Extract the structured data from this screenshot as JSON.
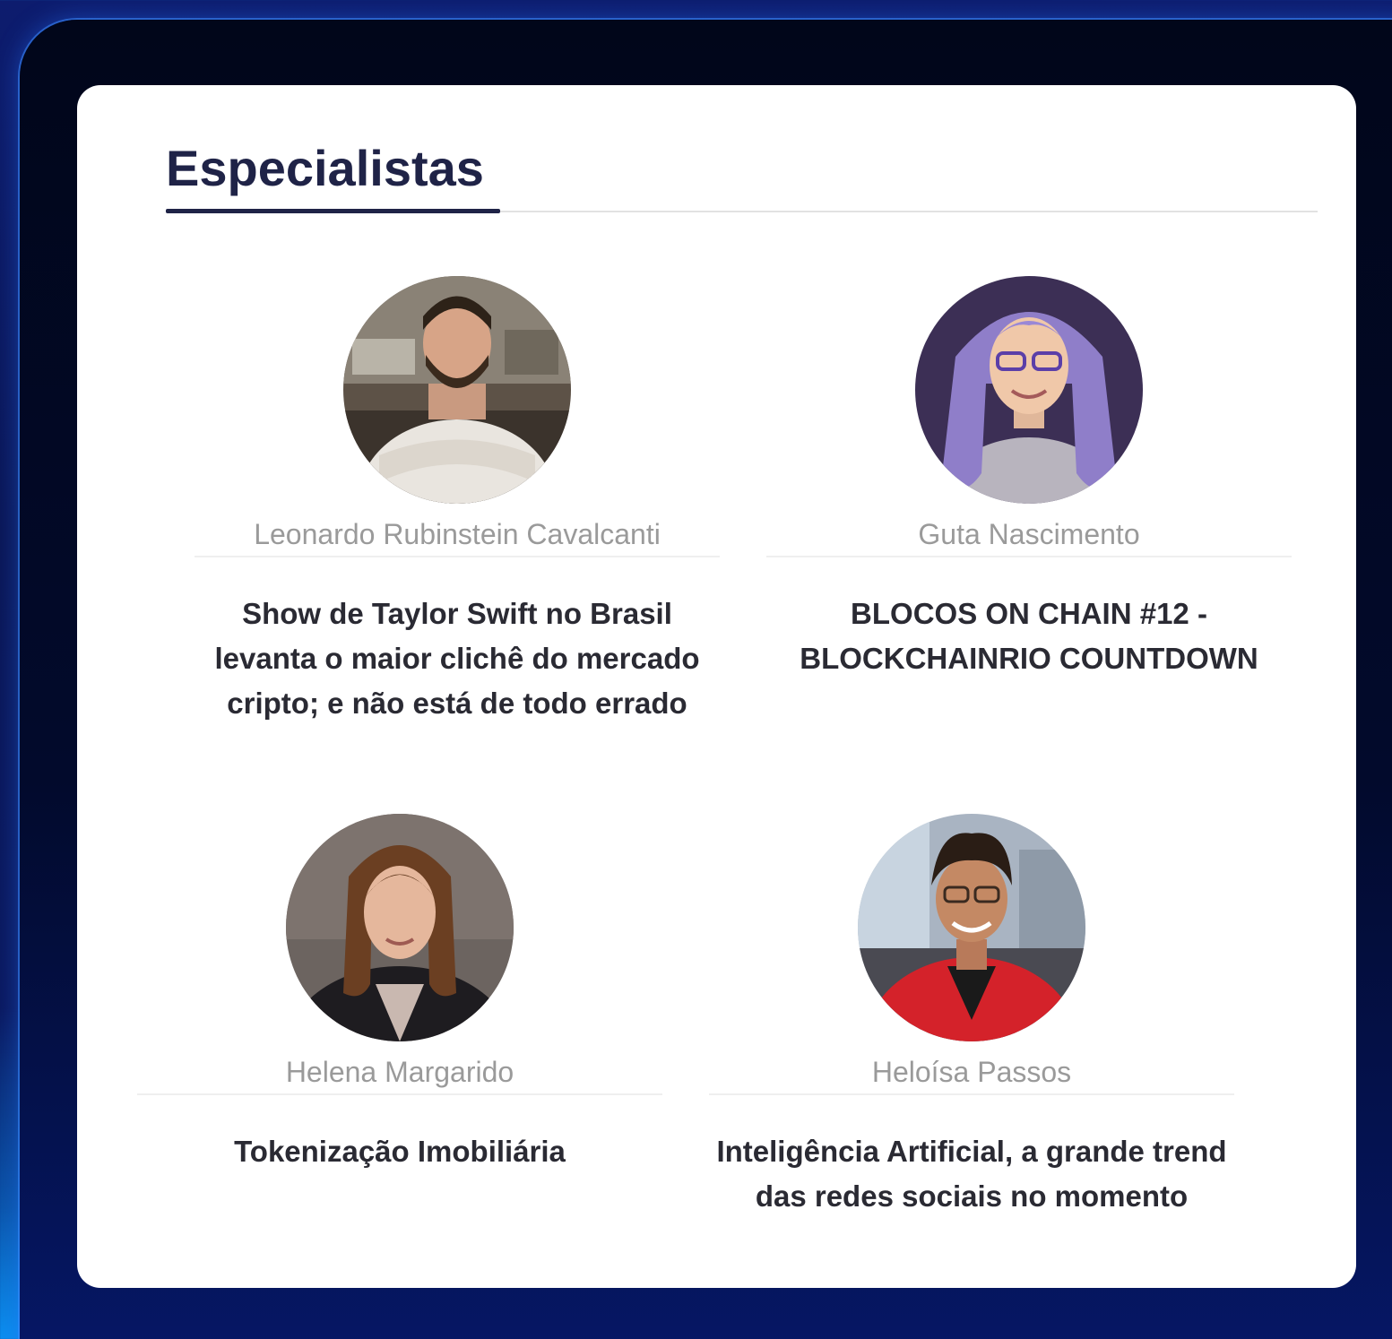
{
  "section": {
    "title": "Especialistas"
  },
  "experts": [
    {
      "name": "Leonardo Rubinstein Cavalcanti",
      "article": "Show de Taylor Swift no Brasil levanta o maior clichê do mercado cripto; e não está de todo errado"
    },
    {
      "name": "Guta Nascimento",
      "article": "BLOCOS ON CHAIN #12 - BLOCKCHAINRIO COUNTDOWN"
    },
    {
      "name": "Helena Margarido",
      "article": "Tokenização Imobiliária"
    },
    {
      "name": "Heloísa Passos",
      "article": "Inteligência Artificial, a grande trend das redes sociais no momento"
    }
  ],
  "colors": {
    "title": "#1f2347",
    "name": "#9a9a9a",
    "article": "#2a2a33",
    "frame_glow": "#3c8cff"
  }
}
